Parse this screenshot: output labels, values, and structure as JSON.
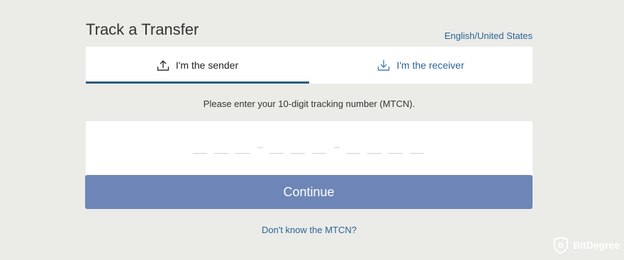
{
  "header": {
    "title": "Track a Transfer",
    "language_link": "English/United States"
  },
  "tabs": [
    {
      "label": "I'm the sender",
      "icon": "upload-icon",
      "active": true
    },
    {
      "label": "I'm the receiver",
      "icon": "download-icon",
      "active": false
    }
  ],
  "form": {
    "instructions": "Please enter your 10-digit tracking number (MTCN).",
    "mtcn_value": "",
    "mtcn_digits": 10,
    "continue_label": "Continue",
    "help_link": "Don't know the MTCN?"
  },
  "watermark": {
    "text": "BitDegree"
  },
  "colors": {
    "accent": "#6e86b7",
    "link": "#2a6496",
    "active_tab_underline": "#2e5a7e",
    "background": "#ebebe7"
  }
}
